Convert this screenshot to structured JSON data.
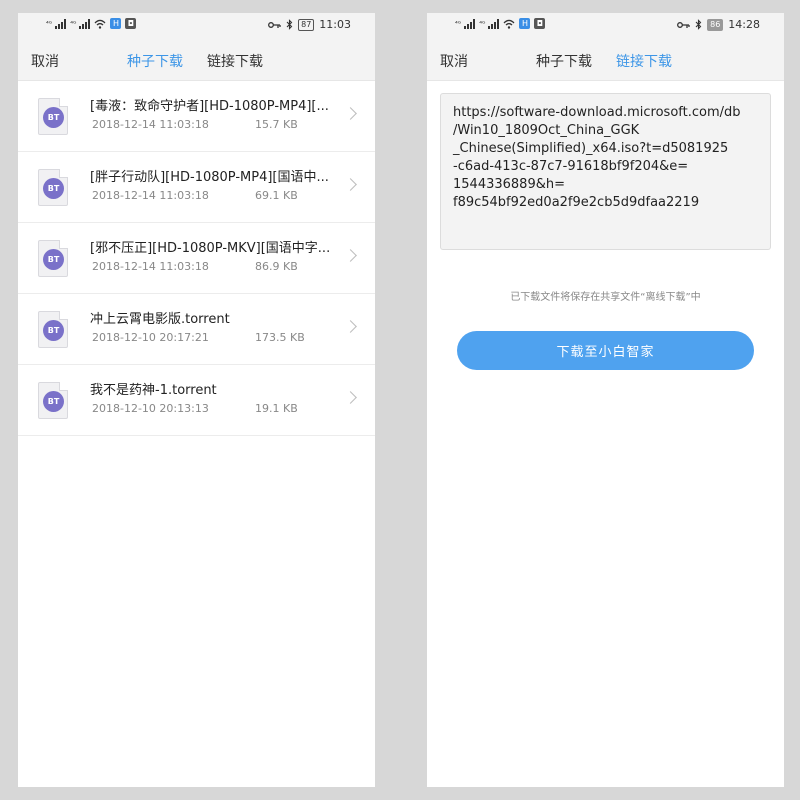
{
  "left": {
    "status": {
      "battery": "87",
      "time": "11:03"
    },
    "nav": {
      "cancel": "取消",
      "tab_torrent": "种子下载",
      "tab_link": "链接下载",
      "active_tab": "tab_torrent"
    },
    "files": [
      {
        "badge": "BT",
        "name": "[毒液：致命守护者][HD-1080P-MP4][...",
        "date": "2018-12-14 11:03:18",
        "size": "15.7 KB"
      },
      {
        "badge": "BT",
        "name": "[胖子行动队][HD-1080P-MP4][国语中...",
        "date": "2018-12-14 11:03:18",
        "size": "69.1 KB"
      },
      {
        "badge": "BT",
        "name": "[邪不压正][HD-1080P-MKV][国语中字...",
        "date": "2018-12-14 11:03:18",
        "size": "86.9 KB"
      },
      {
        "badge": "BT",
        "name": "冲上云霄电影版.torrent",
        "date": "2018-12-10 20:17:21",
        "size": "173.5 KB"
      },
      {
        "badge": "BT",
        "name": "我不是药神-1.torrent",
        "date": "2018-12-10 20:13:13",
        "size": "19.1 KB"
      }
    ]
  },
  "right": {
    "status": {
      "battery": "86",
      "time": "14:28"
    },
    "nav": {
      "cancel": "取消",
      "tab_torrent": "种子下载",
      "tab_link": "链接下载",
      "active_tab": "tab_link"
    },
    "url_value": "https://software-download.microsoft.com/db\n/Win10_1809Oct_China_GGK\n_Chinese(Simplified)_x64.iso?t=d5081925\n-c6ad-413c-87c7-91618bf9f204&e=\n1544336889&h=\nf89c54bf92ed0a2f9e2cb5d9dfaa2219",
    "hint": "已下载文件将保存在共享文件“离线下载”中",
    "download_button": "下载至小白智家"
  },
  "colors": {
    "accent": "#3d96e7",
    "button": "#4fa2ef",
    "bt_badge": "#7a71c9",
    "background": "#d7d7d7"
  },
  "icons": {
    "wifi": "wifi-icon",
    "key": "key-icon",
    "bluetooth": "bluetooth-icon",
    "chevron": "chevron-right-icon"
  }
}
